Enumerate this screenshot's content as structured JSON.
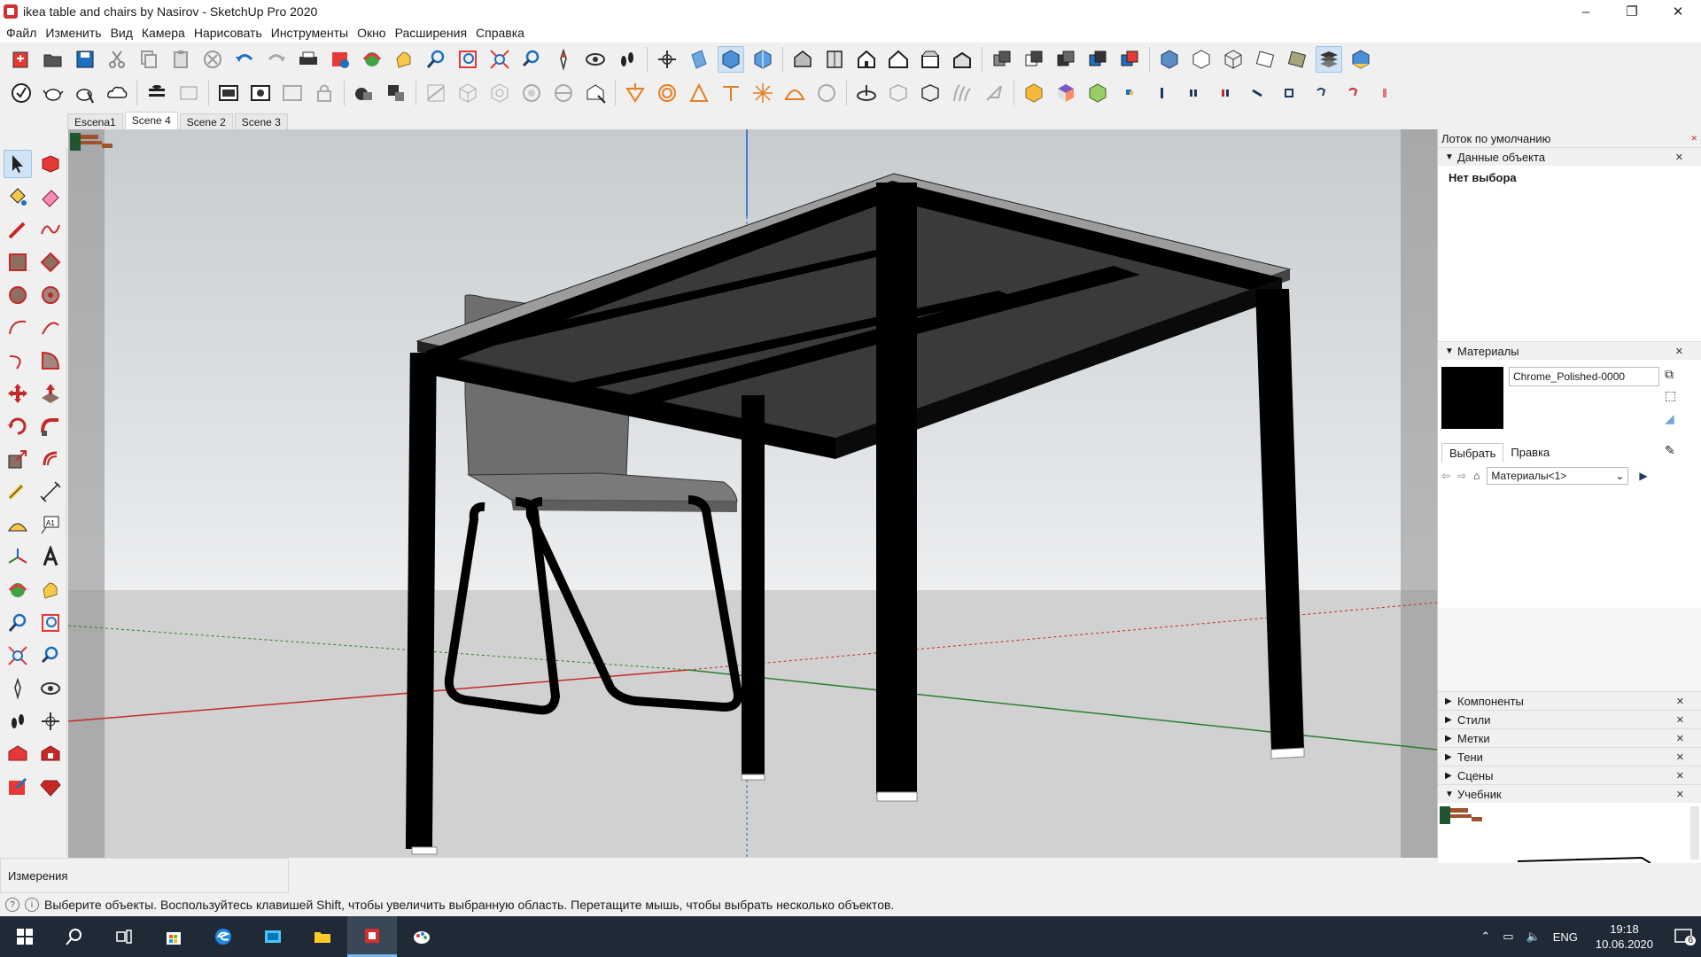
{
  "window": {
    "title": "ikea table and chairs by Nasirov - SketchUp Pro 2020",
    "minimize": "–",
    "maximize": "❐",
    "close": "✕"
  },
  "menu": [
    "Файл",
    "Изменить",
    "Вид",
    "Камера",
    "Нарисовать",
    "Инструменты",
    "Окно",
    "Расширения",
    "Справка"
  ],
  "scenes": [
    "Escena1",
    "Scene 4",
    "Scene 2",
    "Scene 3"
  ],
  "active_scene": "Scene 4",
  "tray": {
    "title": "Лоток по умолчанию",
    "entity_info": {
      "header": "Данные объекта",
      "body": "Нет выбора"
    },
    "materials": {
      "header": "Материалы",
      "name": "Chrome_Polished-0000",
      "tab_select": "Выбрать",
      "tab_edit": "Правка",
      "library": "Материалы<1>",
      "swatch_color": "#000000"
    },
    "collapsed": [
      "Компоненты",
      "Стили",
      "Метки",
      "Тени",
      "Сцены"
    ],
    "tutorial": "Учебник"
  },
  "measurements_label": "Измерения",
  "status_text": "Выберите объекты. Воспользуйтесь клавишей Shift, чтобы увеличить выбранную область. Перетащите мышь, чтобы выбрать несколько объектов.",
  "taskbar": {
    "lang": "ENG",
    "time": "19:18",
    "date": "10.06.2020",
    "notifications": "6"
  },
  "colors": {
    "sky_top": "#c8ccd0",
    "ground": "#cfcfcf",
    "axis_red": "#c62828",
    "axis_green": "#2e7d32",
    "axis_blue": "#1565c0",
    "brand_red": "#d32f2f"
  }
}
